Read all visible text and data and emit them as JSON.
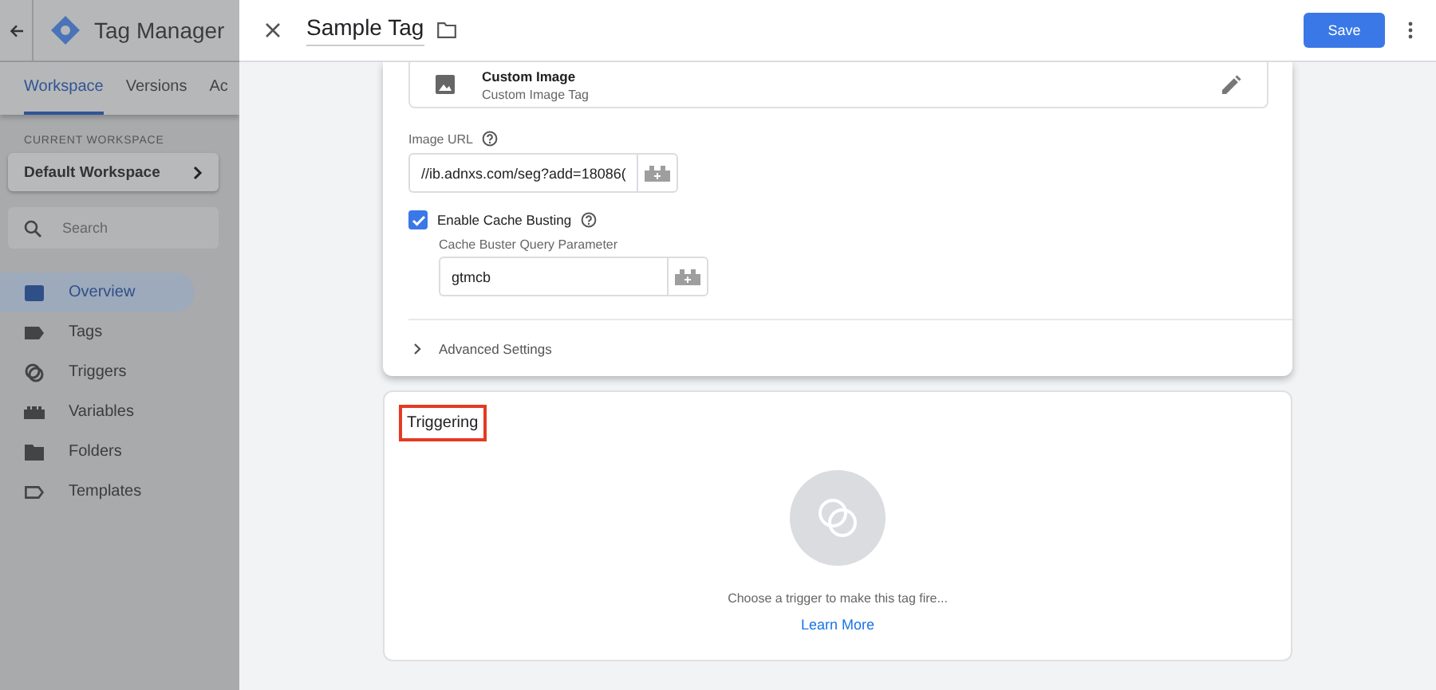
{
  "app": {
    "title": "Tag Manager",
    "tabs": [
      {
        "label": "Workspace",
        "selected": true
      },
      {
        "label": "Versions",
        "selected": false
      },
      {
        "label": "Ac",
        "selected": false
      }
    ],
    "workspace_label": "CURRENT WORKSPACE",
    "workspace": "Default Workspace",
    "search": {
      "placeholder": "Search"
    },
    "nav": [
      {
        "kind": "overview",
        "label": "Overview",
        "selected": true
      },
      {
        "kind": "tag",
        "label": "Tags",
        "selected": false
      },
      {
        "kind": "trigger",
        "label": "Triggers",
        "selected": false
      },
      {
        "kind": "variable",
        "label": "Variables",
        "selected": false
      },
      {
        "kind": "folder",
        "label": "Folders",
        "selected": false
      },
      {
        "kind": "template",
        "label": "Templates",
        "selected": false
      }
    ]
  },
  "editor": {
    "title": "Sample Tag",
    "save": "Save",
    "tag_type": {
      "name": "Custom Image",
      "subtitle": "Custom Image Tag"
    },
    "image_url": {
      "label": "Image URL",
      "value": "//ib.adnxs.com/seg?add=18086("
    },
    "cache_busting": {
      "label": "Enable Cache Busting",
      "checked": true,
      "param_label": "Cache Buster Query Parameter",
      "param_value": "gtmcb"
    },
    "advanced": {
      "label": "Advanced Settings",
      "expanded": false
    },
    "triggering": {
      "title": "Triggering",
      "highlighted": true,
      "message": "Choose a trigger to make this tag fire...",
      "link": "Learn More"
    }
  }
}
